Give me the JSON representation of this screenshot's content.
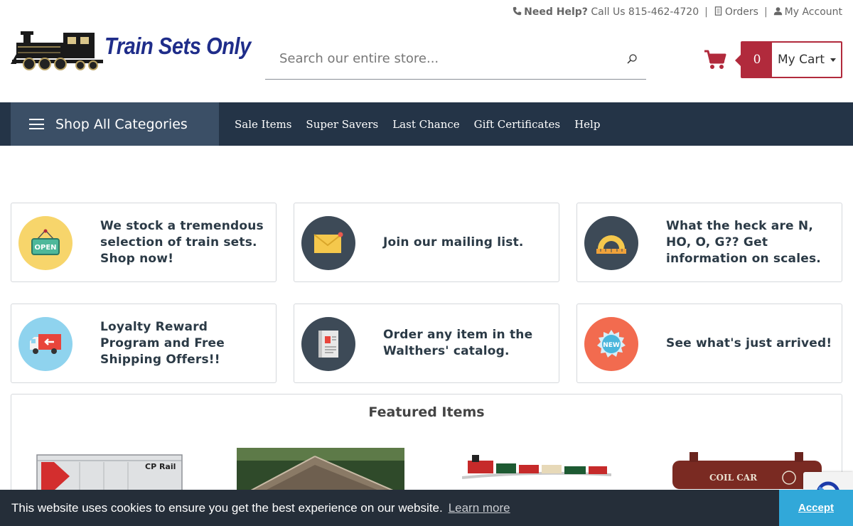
{
  "utility": {
    "need_help": "Need Help?",
    "call_us": "Call Us 815-462-4720",
    "sep": "|",
    "orders": "Orders",
    "account": "My Account"
  },
  "header": {
    "logo_text": "Train Sets Only",
    "search_placeholder": "Search our entire store...",
    "cart_count": "0",
    "cart_label": "My Cart"
  },
  "nav": {
    "shop_all": "Shop All Categories",
    "links": [
      "Sale Items",
      "Super Savers",
      "Last Chance",
      "Gift Certificates",
      "Help"
    ]
  },
  "cards": [
    {
      "text": "We stock a tremendous selection of train sets. Shop now!",
      "icon": "open-sign-icon",
      "color": "#f7d56b"
    },
    {
      "text": "Join our mailing list.",
      "icon": "envelope-icon",
      "color": "#3d4a57"
    },
    {
      "text": "What the heck are N, HO, O, G?? Get information on scales.",
      "icon": "protractor-icon",
      "color": "#3d4a57"
    },
    {
      "text": "Loyalty Reward Program and Free Shipping Offers!!",
      "icon": "delivery-truck-icon",
      "color": "#8fd3ee"
    },
    {
      "text": "Order any item in the Walthers' catalog.",
      "icon": "catalog-icon",
      "color": "#3d4a57"
    },
    {
      "text": "See what's just arrived!",
      "icon": "new-badge-icon",
      "color": "#f26b4f"
    }
  ],
  "featured": {
    "title": "Featured Items",
    "car1_text": "CP Rail",
    "car4_text": "COIL CAR"
  },
  "cookie": {
    "message": "This website uses cookies to ensure you get the best experience on our website.",
    "learn_more": "Learn more",
    "accept": "Accept"
  },
  "colors": {
    "accent_red": "#b12a3c",
    "nav_bg": "#243447",
    "shop_all_bg": "#3b4f66",
    "cookie_bg": "#252e39",
    "accept_bg": "#31a8d9"
  }
}
